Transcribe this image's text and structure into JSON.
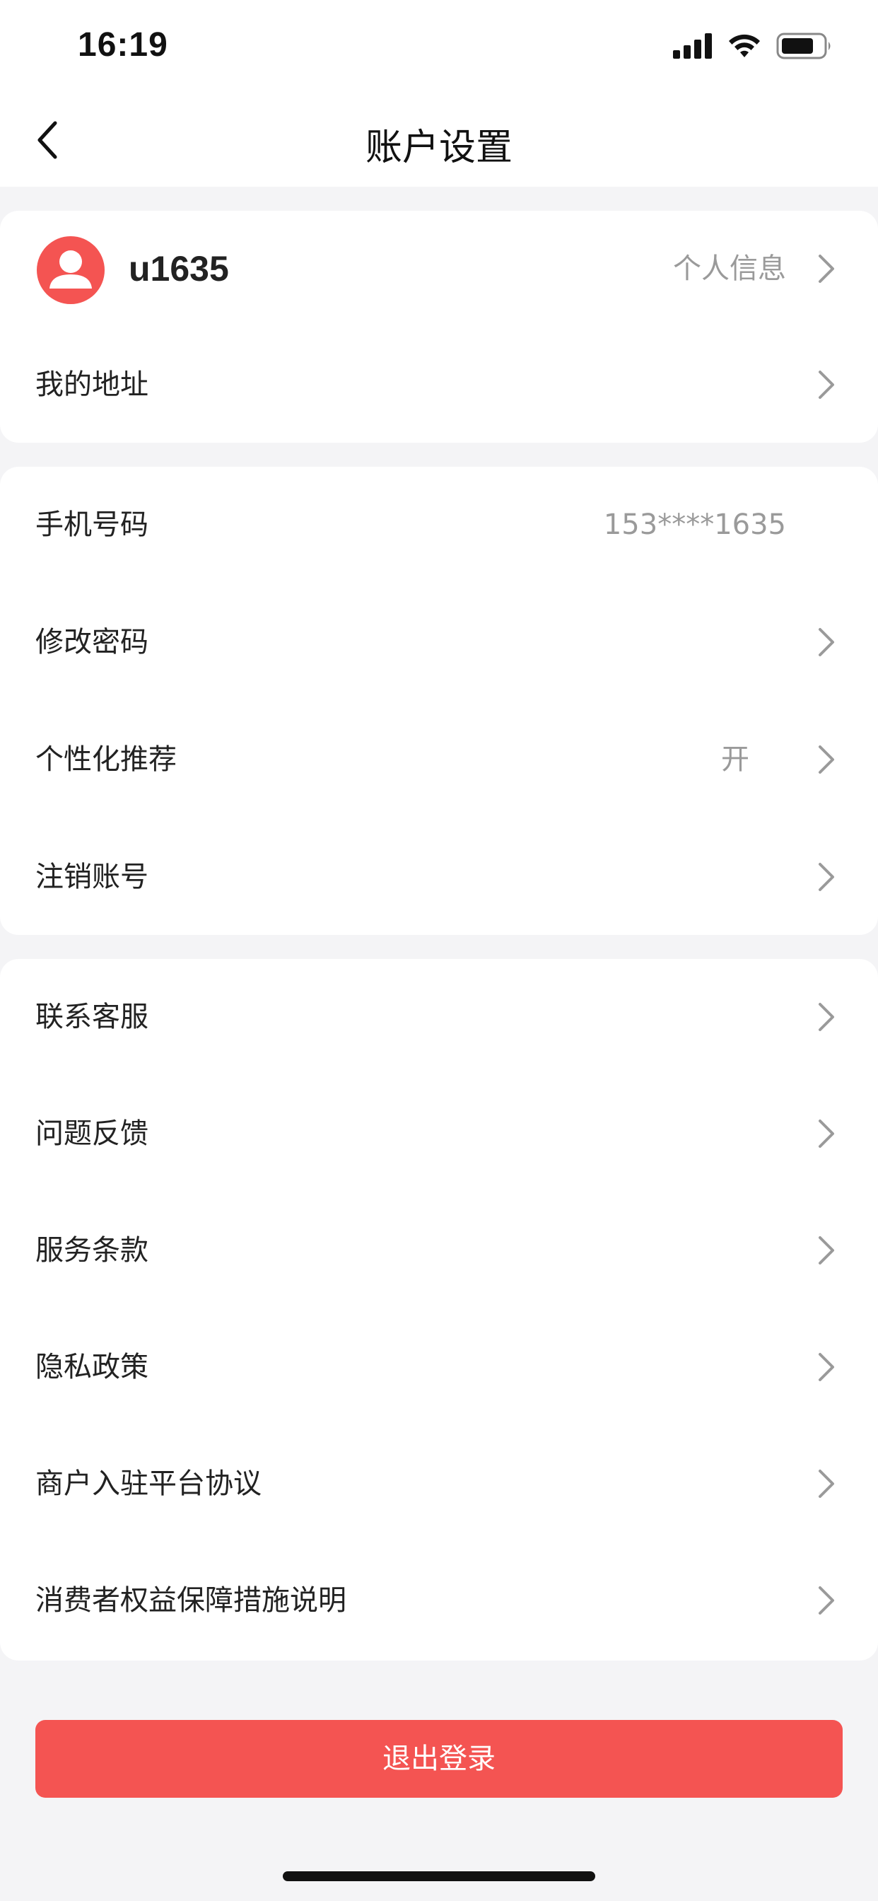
{
  "status_bar": {
    "time": "16:19",
    "icons": [
      "cellular-signal-icon",
      "wifi-icon",
      "battery-icon"
    ]
  },
  "header": {
    "title": "账户设置",
    "back_icon": "chevron-left-icon"
  },
  "profile": {
    "username": "u1635",
    "link_label": "个人信息",
    "avatar_icon": "user-avatar-icon"
  },
  "sections": [
    {
      "items": [
        {
          "label": "我的地址",
          "value": "",
          "chevron": true
        }
      ]
    },
    {
      "items": [
        {
          "label": "手机号码",
          "value": "153****1635",
          "chevron": false
        },
        {
          "label": "修改密码",
          "value": "",
          "chevron": true
        },
        {
          "label": "个性化推荐",
          "value": "开",
          "chevron": true
        },
        {
          "label": "注销账号",
          "value": "",
          "chevron": true
        }
      ]
    },
    {
      "items": [
        {
          "label": "联系客服",
          "value": "",
          "chevron": true
        },
        {
          "label": "问题反馈",
          "value": "",
          "chevron": true
        },
        {
          "label": "服务条款",
          "value": "",
          "chevron": true
        },
        {
          "label": "隐私政策",
          "value": "",
          "chevron": true
        },
        {
          "label": "商户入驻平台协议",
          "value": "",
          "chevron": true
        },
        {
          "label": "消费者权益保障措施说明",
          "value": "",
          "chevron": true
        }
      ]
    }
  ],
  "logout": {
    "label": "退出登录"
  },
  "colors": {
    "accent": "#f45452",
    "background": "#f4f4f6",
    "muted_text": "#9a9a9a",
    "chevron": "#9a9a9a"
  }
}
